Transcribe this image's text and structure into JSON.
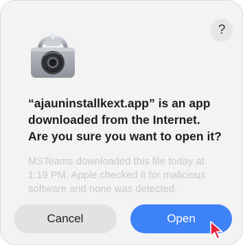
{
  "dialog": {
    "help_label": "?",
    "title_lines": [
      "“ajauninstallkext.app” is an app",
      "downloaded from the Internet.",
      "Are you sure you want to open it?"
    ],
    "message_lines": [
      "MSTeams downloaded this file today at",
      "1:19 PM. Apple checked it for malicious",
      "software and none was detected."
    ],
    "cancel_label": "Cancel",
    "open_label": "Open",
    "icon": "gatekeeper-lock-icon"
  },
  "colors": {
    "accent": "#3e82f7",
    "cancel_bg": "#e2e2e2",
    "dialog_bg": "#f3f3f3",
    "cursor": "#e8213b"
  }
}
